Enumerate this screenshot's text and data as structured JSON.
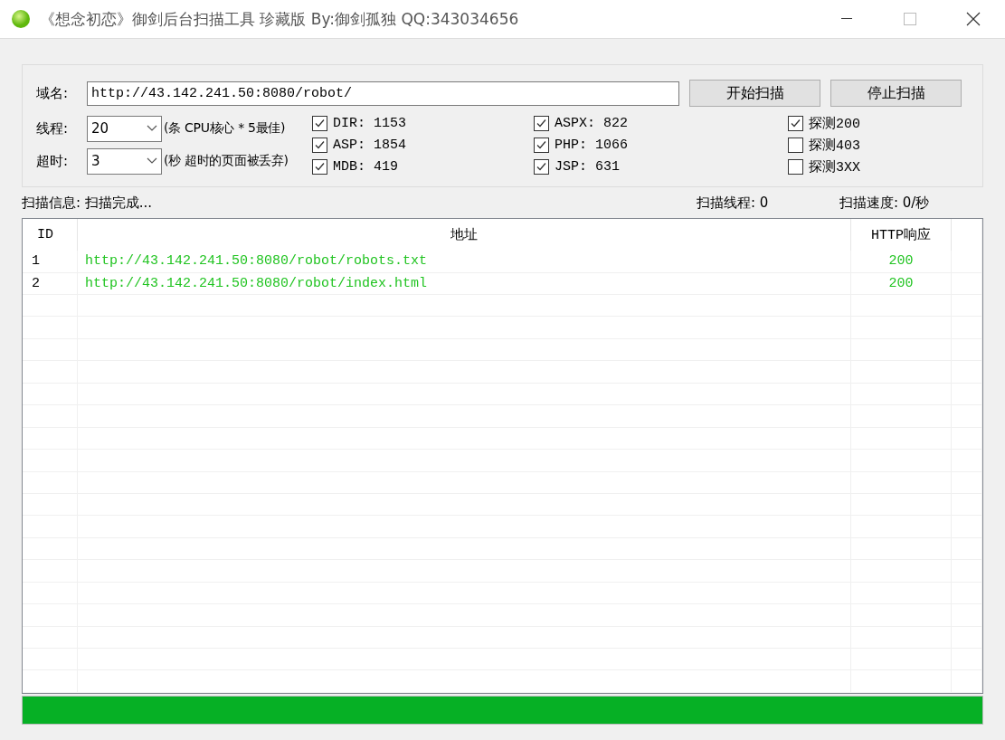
{
  "window": {
    "title": "《想念初恋》御剑后台扫描工具 珍藏版 By:御剑孤独 QQ:343034656"
  },
  "domain": {
    "label": "域名:",
    "value": "http://43.142.241.50:8080/robot/"
  },
  "buttons": [
    "开始扫描",
    "停止扫描"
  ],
  "threads": {
    "label": "线程:",
    "value": "20",
    "hint": "(条 CPU核心 * 5最佳)"
  },
  "timeout": {
    "label": "超时:",
    "value": "3",
    "hint": "(秒 超时的页面被丢弃)"
  },
  "dictionary_columns": [
    [
      {
        "label": "DIR: 1153",
        "checked": true
      },
      {
        "label": "ASP: 1854",
        "checked": true
      },
      {
        "label": "MDB: 419",
        "checked": true
      }
    ],
    [
      {
        "label": "ASPX: 822",
        "checked": true
      },
      {
        "label": "PHP: 1066",
        "checked": true
      },
      {
        "label": "JSP: 631",
        "checked": true
      }
    ]
  ],
  "probes": [
    {
      "label": "探测200",
      "checked": true
    },
    {
      "label": "探测403",
      "checked": false
    },
    {
      "label": "探测3XX",
      "checked": false
    }
  ],
  "status": {
    "info": "扫描信息: 扫描完成...",
    "threads": "扫描线程: 0",
    "speed": "扫描速度: 0/秒"
  },
  "table": {
    "columns": [
      "ID",
      "地址",
      "HTTP响应"
    ],
    "rows": [
      {
        "id": "1",
        "url": "http://43.142.241.50:8080/robot/robots.txt",
        "code": "200"
      },
      {
        "id": "2",
        "url": "http://43.142.241.50:8080/robot/index.html",
        "code": "200"
      }
    ]
  },
  "progress": {
    "level": 1
  }
}
